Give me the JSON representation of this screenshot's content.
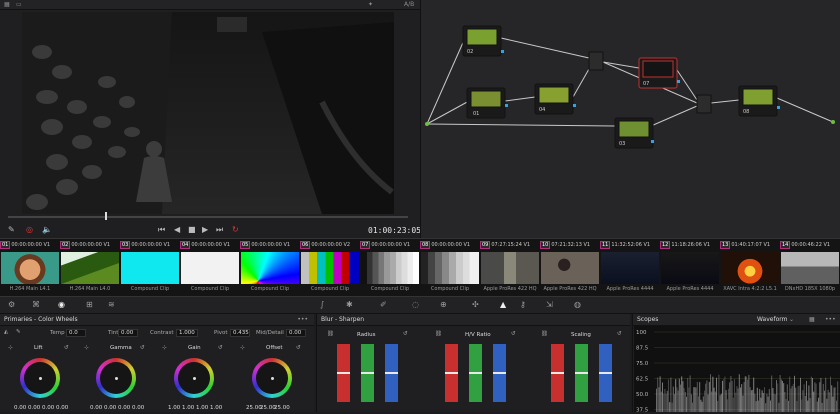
{
  "viewer": {
    "timecode": "01:00:23:05",
    "top_right_label": "A/B"
  },
  "clips": [
    {
      "num": "01",
      "tc": "00:00:00:00",
      "track": "V1",
      "label": "H.264 Main L4.1",
      "thumb": "portrait"
    },
    {
      "num": "02",
      "tc": "00:00:00:00",
      "track": "V1",
      "label": "H.264 Main L4.0",
      "thumb": "green"
    },
    {
      "num": "03",
      "tc": "00:00:00:00",
      "track": "V1",
      "label": "Compound Clip",
      "thumb": "cyan"
    },
    {
      "num": "04",
      "tc": "00:00:00:00",
      "track": "V1",
      "label": "Compound Clip",
      "thumb": "white"
    },
    {
      "num": "05",
      "tc": "00:00:00:00",
      "track": "V1",
      "label": "Compound Clip",
      "thumb": "gradient"
    },
    {
      "num": "06",
      "tc": "00:00:00:00",
      "track": "V2",
      "label": "Compound Clip",
      "thumb": "bars"
    },
    {
      "num": "07",
      "tc": "00:00:00:00",
      "track": "V1",
      "label": "Compound Clip",
      "thumb": "steps"
    },
    {
      "num": "08",
      "tc": "00:00:00:00",
      "track": "V1",
      "label": "Compound Clip",
      "thumb": "steps2"
    },
    {
      "num": "09",
      "tc": "07:27:15:24",
      "track": "V1",
      "label": "Apple ProRes 422 HQ",
      "thumb": "room"
    },
    {
      "num": "10",
      "tc": "07:21:32:13",
      "track": "V1",
      "label": "Apple ProRes 422 HQ",
      "thumb": "room2"
    },
    {
      "num": "11",
      "tc": "11:32:52:06",
      "track": "V1",
      "label": "Apple ProRes 4444",
      "thumb": "night"
    },
    {
      "num": "12",
      "tc": "11:18:26:06",
      "track": "V1",
      "label": "Apple ProRes 4444",
      "thumb": "night2"
    },
    {
      "num": "13",
      "tc": "01:40:17:07",
      "track": "V1",
      "label": "XAVC Intra 4:2:2 L5.1",
      "thumb": "fire"
    },
    {
      "num": "14",
      "tc": "00:00:46:22",
      "track": "V1",
      "label": "DNxHD 185X 1080p",
      "thumb": "street"
    }
  ],
  "primaries": {
    "title": "Primaries - Color Wheels",
    "temp_label": "Temp",
    "temp": "0.0",
    "tint_label": "Tint",
    "tint": "0.00",
    "contrast_label": "Contrast",
    "contrast": "1.000",
    "pivot_label": "Pivot",
    "pivot": "0.435",
    "middetail_label": "Mid/Detail",
    "middetail": "0.00",
    "wheels": [
      {
        "name": "Lift",
        "values": [
          "0.00",
          "0.00",
          "0.00",
          "0.00"
        ]
      },
      {
        "name": "Gamma",
        "values": [
          "0.00",
          "0.00",
          "0.00",
          "0.00"
        ]
      },
      {
        "name": "Gain",
        "values": [
          "1.00",
          "1.00",
          "1.00",
          "1.00"
        ]
      },
      {
        "name": "Offset",
        "values": [
          "25.00",
          "25.00",
          "25.00"
        ]
      }
    ]
  },
  "blur": {
    "title": "Blur - Sharpen",
    "groups": [
      {
        "name": "Radius",
        "level": 0.5
      },
      {
        "name": "H/V Ratio",
        "level": 0.5
      },
      {
        "name": "Scaling",
        "level": 0.5
      }
    ]
  },
  "scopes": {
    "title": "Scopes",
    "mode": "Waveform",
    "ticks": [
      "1023",
      "896",
      "768",
      "640",
      "512",
      "384",
      "256",
      "128",
      "0"
    ],
    "visible_ticks": [
      "100",
      "87.5",
      "75.0",
      "62.5",
      "50.0",
      "37.5"
    ]
  },
  "nodes": [
    {
      "label": "01",
      "thumb": "green"
    },
    {
      "label": "02",
      "thumb": "green"
    },
    {
      "label": "03",
      "thumb": "green"
    },
    {
      "label": "04",
      "thumb": "green"
    },
    {
      "label": "07",
      "thumb": "dark"
    },
    {
      "label": "08",
      "thumb": "green"
    }
  ],
  "colors": {
    "accent": "#d23a3a",
    "node_link": "#c8c8c8",
    "clip_border": "#b03080"
  }
}
